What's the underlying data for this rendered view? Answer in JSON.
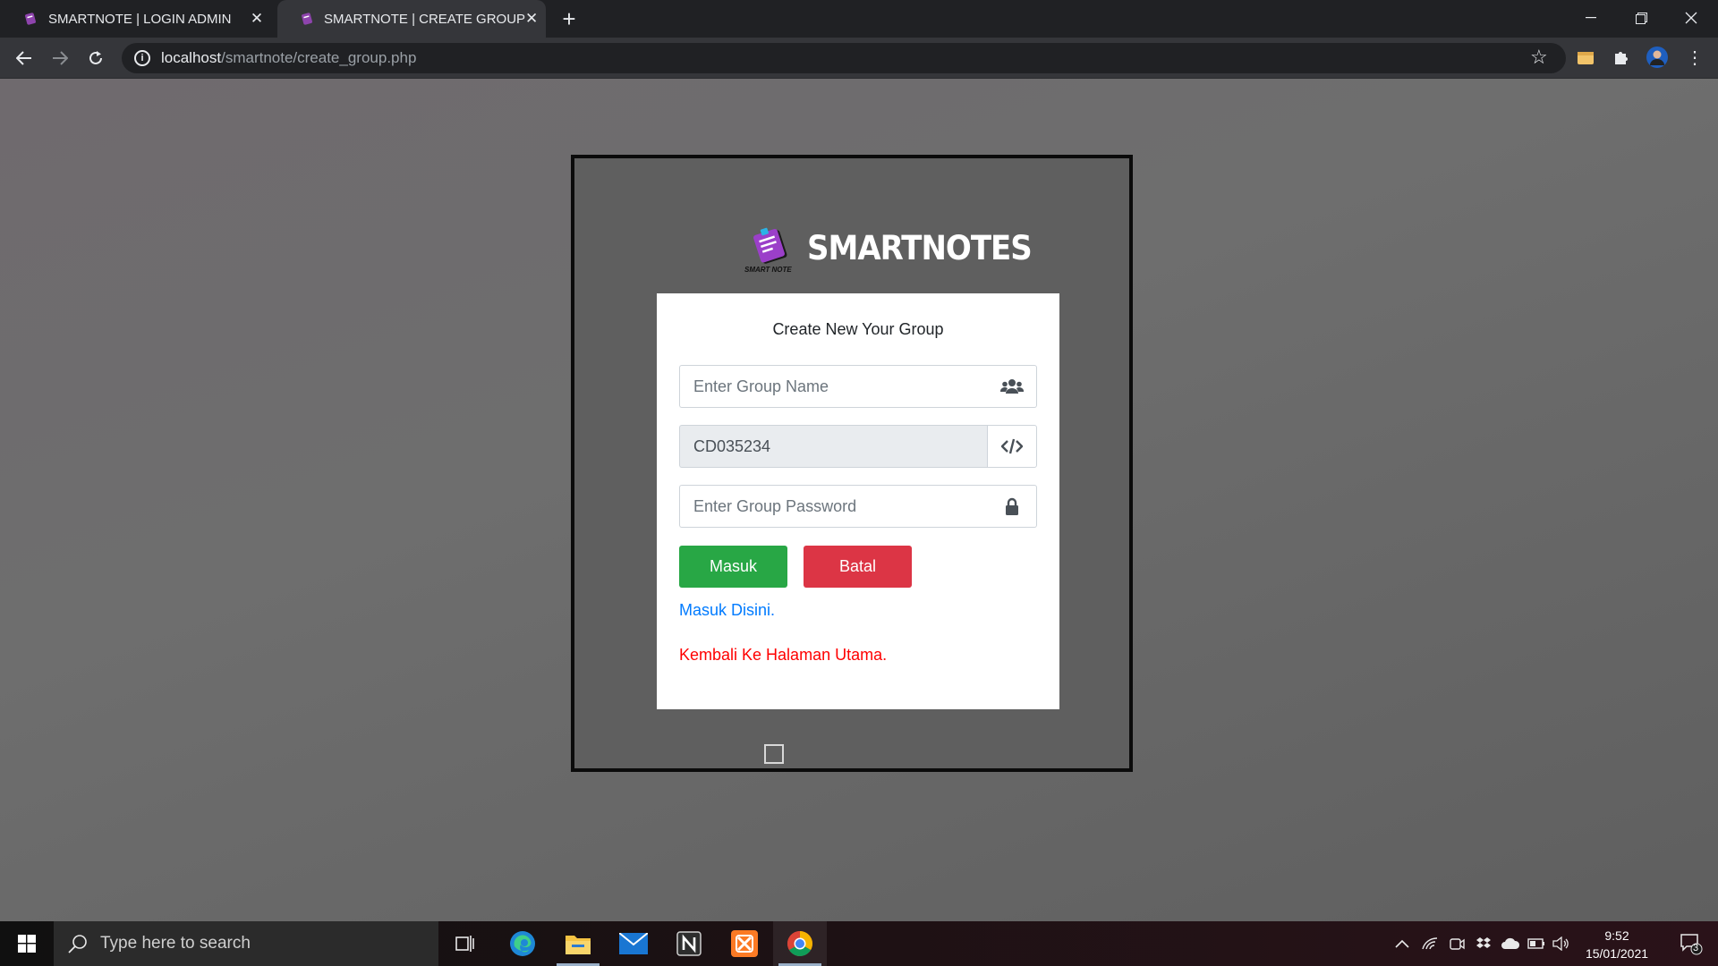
{
  "browser": {
    "tabs": [
      {
        "title": "SMARTNOTE | LOGIN ADMIN"
      },
      {
        "title": "SMARTNOTE | CREATE GROUP"
      }
    ],
    "url_host": "localhost",
    "url_path": "/smartnote/create_group.php"
  },
  "page": {
    "brand": {
      "name": "SMARTNOTES",
      "logo_text": "SMART NOTE"
    },
    "form": {
      "title": "Create New Your Group",
      "group_name_placeholder": "Enter Group Name",
      "group_code_value": "CD035234",
      "group_password_placeholder": "Enter Group Password",
      "submit_label": "Masuk",
      "cancel_label": "Batal",
      "login_link": "Masuk Disini.",
      "home_link": "Kembali Ke Halaman Utama."
    }
  },
  "taskbar": {
    "search_placeholder": "Type here to search",
    "time": "9:52",
    "date": "15/01/2021",
    "notification_count": "3"
  },
  "colors": {
    "success": "#28a745",
    "danger": "#dc3545",
    "link": "#007bff",
    "link_red": "#ff0000"
  }
}
